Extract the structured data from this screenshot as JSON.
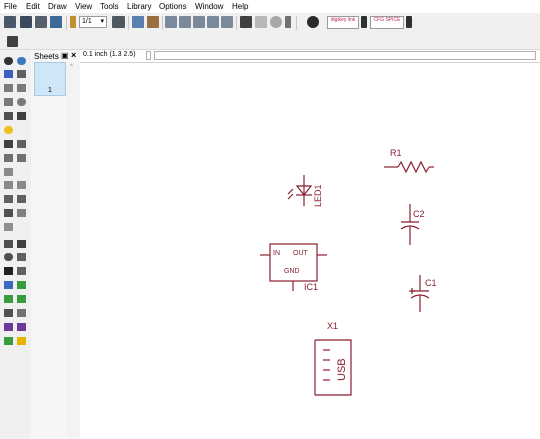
{
  "menu": [
    "File",
    "Edit",
    "Draw",
    "View",
    "Tools",
    "Library",
    "Options",
    "Window",
    "Help"
  ],
  "toolbar": {
    "sheet_select": "1/1",
    "link_button_1": "digikey link",
    "link_button_2": "CFG SPICE"
  },
  "sheets_panel": {
    "title": "Sheets",
    "sheet_number": "1"
  },
  "command_bar": {
    "grid_info": "0.1 inch (1.3 2.5)",
    "command_value": ""
  },
  "parts": {
    "r1": "R1",
    "led1": "LED1",
    "c2": "C2",
    "c1": "C1",
    "ic1": "IC1",
    "ic1_in": "IN",
    "ic1_out": "OUT",
    "ic1_gnd": "GND",
    "x1": "X1",
    "x1_body": "USB"
  },
  "colors": {
    "schematic": "#8b1e2e",
    "accent": "#c0284e",
    "sheet_highlight": "#cfe6f7"
  }
}
